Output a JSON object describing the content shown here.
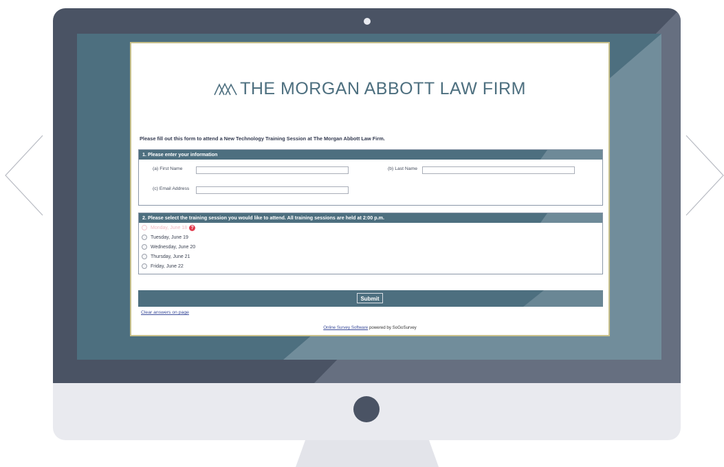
{
  "firm": {
    "title": "THE MORGAN ABBOTT LAW FIRM",
    "logo_icon": "mountain-logo-icon",
    "brand_color": "#4d6f7f"
  },
  "intro": "Please fill out this form to attend a New Technology Training Session at The Morgan Abbott Law Firm.",
  "section1": {
    "heading": "1. Please enter your information",
    "fields": {
      "first_name_label": "(a) First Name",
      "first_name_value": "",
      "last_name_label": "(b) Last Name",
      "last_name_value": "",
      "email_label": "(c) Email Address",
      "email_value": ""
    }
  },
  "section2": {
    "heading": "2. Please select the training session you would like to attend. All training sessions are held at 2:00 p.m.",
    "options": [
      {
        "label": "Monday, June 18",
        "disabled": true,
        "warning_icon": "alert-icon"
      },
      {
        "label": "Tuesday, June 19",
        "disabled": false
      },
      {
        "label": "Wednesday, June 20",
        "disabled": false
      },
      {
        "label": "Thursday, June 21",
        "disabled": false
      },
      {
        "label": "Friday, June 22",
        "disabled": false
      }
    ]
  },
  "submit_label": "Submit",
  "clear_link": "Clear answers on page",
  "footer": {
    "link_text": "Online Survey Software",
    "suffix": " powered by SoGoSurvey"
  },
  "carousel": {
    "prev_icon": "chevron-left-icon",
    "next_icon": "chevron-right-icon"
  }
}
